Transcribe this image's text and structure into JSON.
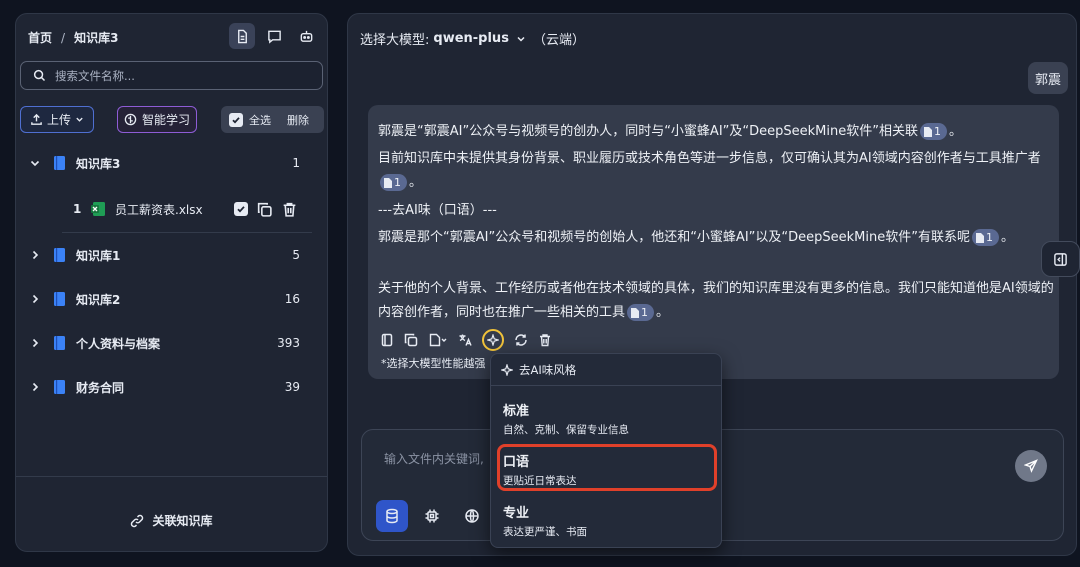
{
  "left": {
    "breadcrumb": {
      "home": "首页",
      "separator": "/",
      "current": "知识库3"
    },
    "search_placeholder": "搜索文件名称...",
    "upload_label": "上传",
    "learn_label": "智能学习",
    "select_all_label": "全选",
    "delete_label": "删除",
    "kbs": [
      {
        "name": "知识库3",
        "count": "1",
        "expanded": true
      },
      {
        "name": "知识库1",
        "count": "5"
      },
      {
        "name": "知识库2",
        "count": "16"
      },
      {
        "name": "个人资料与档案",
        "count": "393"
      },
      {
        "name": "财务合同",
        "count": "39"
      }
    ],
    "file": {
      "index": "1",
      "name": "员工薪资表.xlsx"
    },
    "link_label": "关联知识库"
  },
  "right": {
    "model_prefix": "选择大模型:",
    "model_name": "qwen-plus",
    "model_suffix": "（云端）",
    "user_message": "郭震",
    "answer": {
      "p1": "郭震是“郭震AI”公众号与视频号的创办人，同时与“小蜜蜂AI”及“DeepSeekMine软件”相关联",
      "p2": "目前知识库中未提供其身份背景、职业履历或技术角色等进一步信息，仅可确认其为AI领域内容创作者与工具推广者",
      "p3": "---去AI味（口语）---",
      "p4": "郭震是那个“郭震AI”公众号和视频号的创始人，他还和“小蜜蜂AI”以及“DeepSeekMine软件”有联系呢",
      "p5": "关于他的个人背景、工作经历或者他在技术领域的具体，我们的知识库里没有更多的信息。我们只能知道他是AI领域的内容创作者，同时也在推广一些相关的工具",
      "cite": "1",
      "end": "。",
      "note": "*选择大模型性能越强"
    },
    "input_placeholder": "输入文件内关键词,"
  },
  "dropdown": {
    "header": "去AI味风格",
    "options": [
      {
        "title": "标准",
        "desc": "自然、克制、保留专业信息"
      },
      {
        "title": "口语",
        "desc": "更贴近日常表达"
      },
      {
        "title": "专业",
        "desc": "表达更严谨、书面"
      }
    ],
    "highlighted": "口语"
  },
  "colors": {
    "accent": "#2f55c9",
    "highlight": "#e0402a",
    "ai_button_ring": "#f0c23a",
    "excel": "#1f9d55"
  }
}
